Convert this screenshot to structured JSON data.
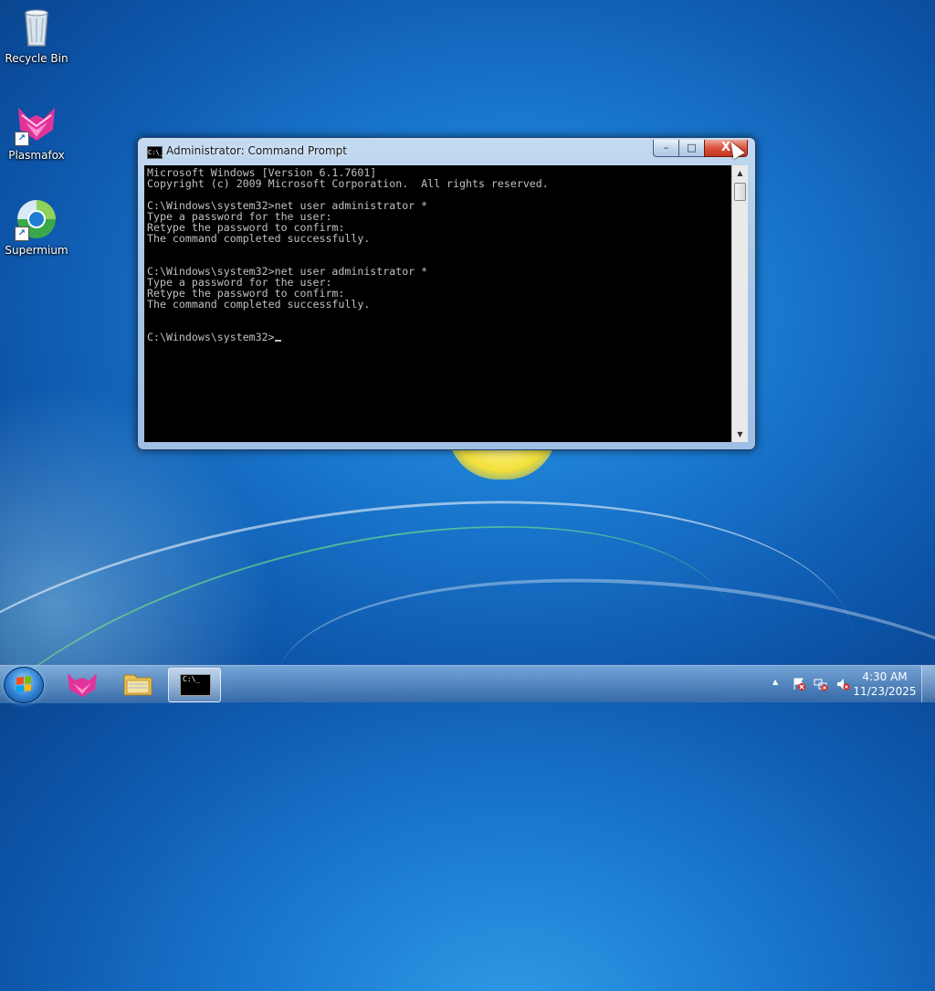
{
  "desktop": {
    "icons": [
      {
        "label": "Recycle Bin"
      },
      {
        "label": "Plasmafox"
      },
      {
        "label": "Supermium"
      }
    ]
  },
  "window": {
    "title": "Administrator: Command Prompt",
    "title_icon_text": "C:\\_",
    "controls": {
      "minimize": "–",
      "maximize": "□",
      "close": "X"
    },
    "console_lines": [
      "Microsoft Windows [Version 6.1.7601]",
      "Copyright (c) 2009 Microsoft Corporation.  All rights reserved.",
      "",
      "C:\\Windows\\system32>net user administrator *",
      "Type a password for the user:",
      "Retype the password to confirm:",
      "The command completed successfully.",
      "",
      "",
      "C:\\Windows\\system32>net user administrator *",
      "Type a password for the user:",
      "Retype the password to confirm:",
      "The command completed successfully.",
      "",
      "",
      "C:\\Windows\\system32>"
    ],
    "scroll_up": "▲",
    "scroll_down": "▼"
  },
  "taskbar": {
    "cmd_icon_text": "C:\\_",
    "tray_expand": "▲",
    "clock_time": "4:30 AM",
    "clock_date": "11/23/2025"
  }
}
